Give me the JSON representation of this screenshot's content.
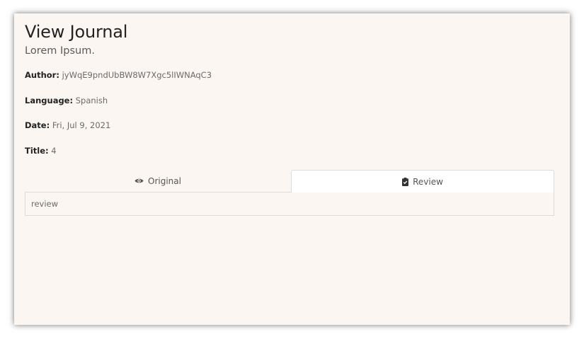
{
  "journal": {
    "title": "View Journal",
    "subtitle": "Lorem Ipsum.",
    "fields": {
      "author_label": "Author:",
      "author_value": "jyWqE9pndUbBW8W7Xgc5lIWNAqC3",
      "language_label": "Language:",
      "language_value": "Spanish",
      "date_label": "Date:",
      "date_value": "Fri, Jul 9, 2021",
      "title_label": "Title:",
      "title_value": "4"
    },
    "tabs": [
      {
        "label": "Original",
        "icon": "eye-icon",
        "active": false
      },
      {
        "label": "Review",
        "icon": "clipboard-check-icon",
        "active": true
      }
    ],
    "panel_content": "review"
  },
  "colors": {
    "card_background": "#fcf6f3",
    "active_tab_background": "#ffffff",
    "border": "#dedad7",
    "heading": "#222222",
    "text": "#6a6a6a"
  }
}
